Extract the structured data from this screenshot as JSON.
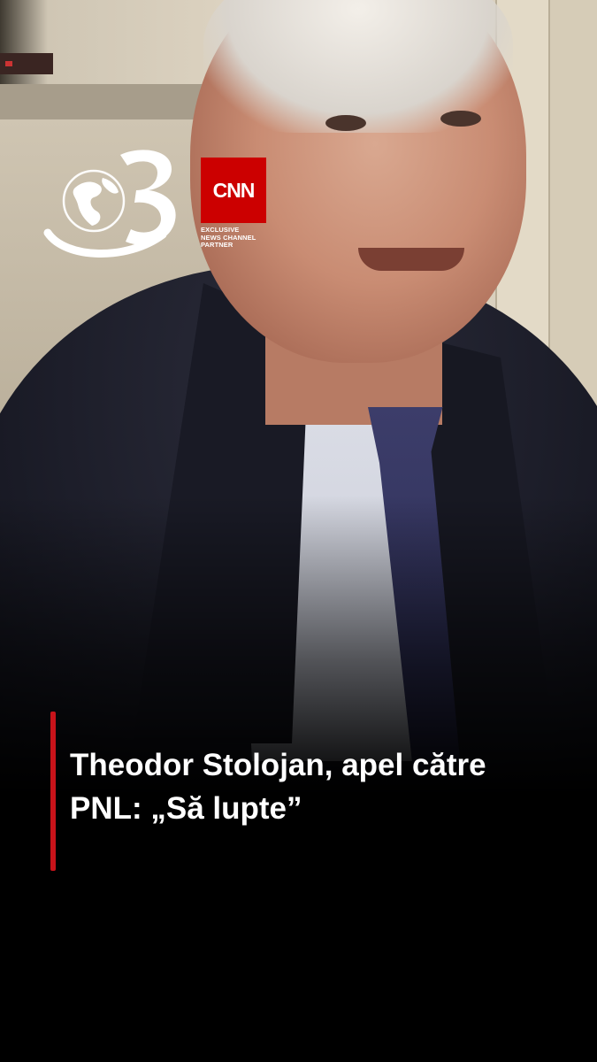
{
  "overlay": {
    "logo": "Antena 3 logo",
    "partner_logo_text": "CNN",
    "partner_tagline": [
      "EXCLUSIVE",
      "NEWS CHANNEL",
      "PARTNER"
    ],
    "headline_lines": [
      "Theodor Stolojan, apel către",
      "PNL: „Să lupte”"
    ],
    "accent_color": "#c8131a",
    "cnn_color": "#cc0000"
  }
}
